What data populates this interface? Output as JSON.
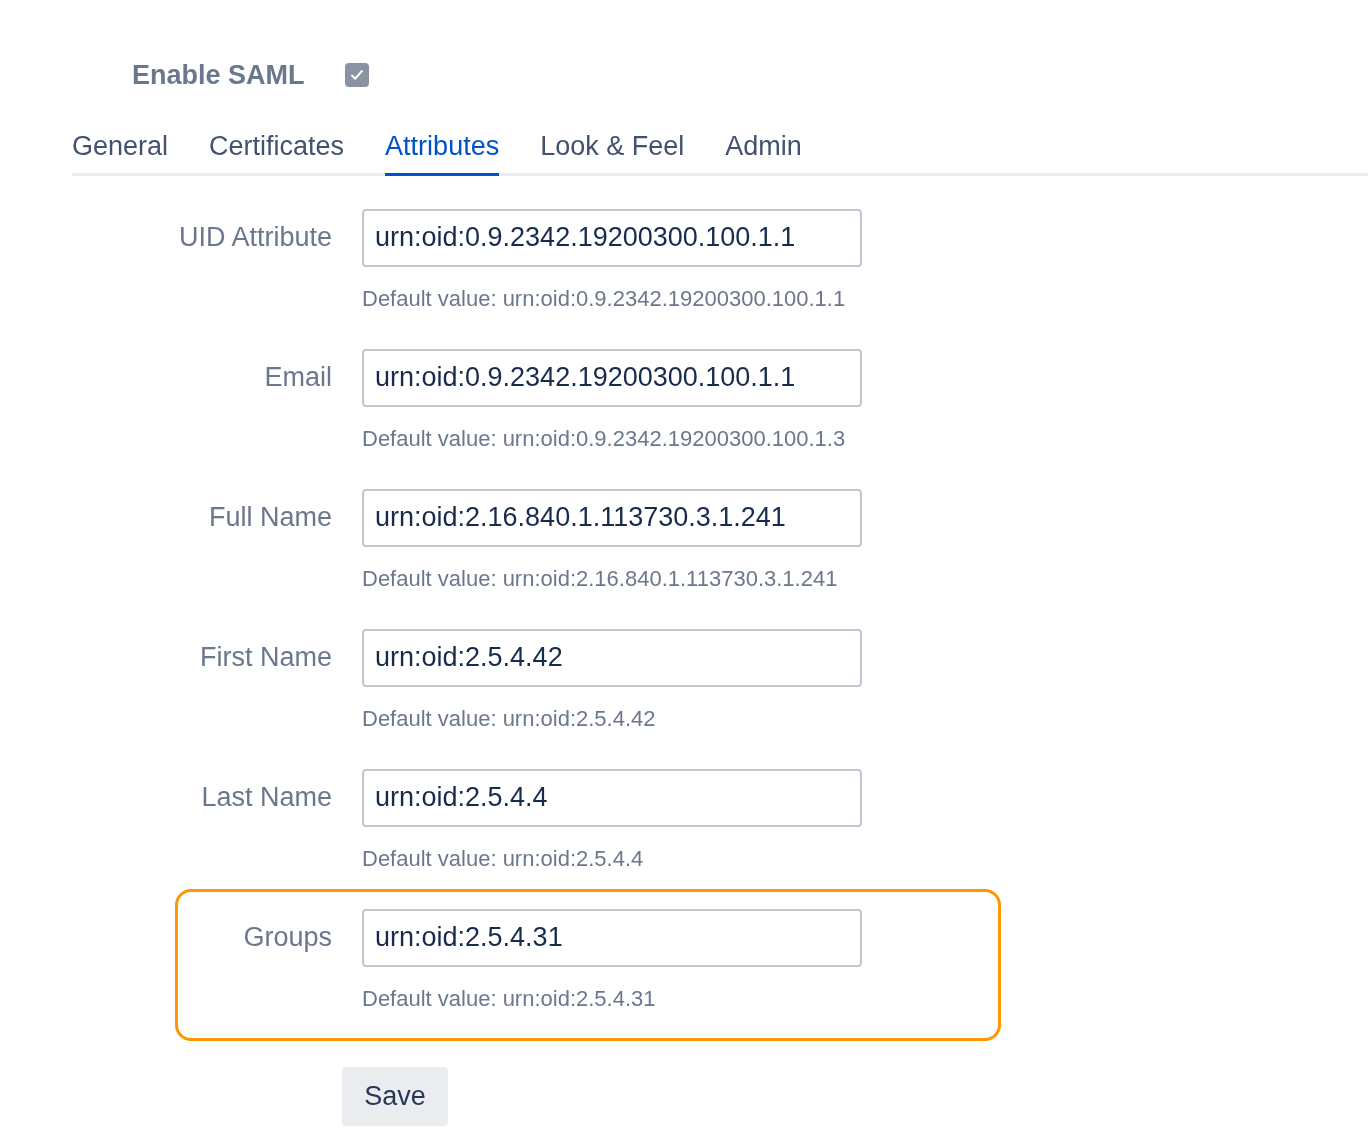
{
  "enable_saml": {
    "label": "Enable SAML",
    "checked": true
  },
  "tabs": [
    {
      "label": "General",
      "selected": false
    },
    {
      "label": "Certificates",
      "selected": false
    },
    {
      "label": "Attributes",
      "selected": true
    },
    {
      "label": "Look & Feel",
      "selected": false
    },
    {
      "label": "Admin",
      "selected": false
    }
  ],
  "fields": [
    {
      "label": "UID Attribute",
      "value": "urn:oid:0.9.2342.19200300.100.1.1",
      "hint": "Default value: urn:oid:0.9.2342.19200300.100.1.1",
      "highlighted": false
    },
    {
      "label": "Email",
      "value": "urn:oid:0.9.2342.19200300.100.1.1",
      "hint": "Default value: urn:oid:0.9.2342.19200300.100.1.3",
      "highlighted": false
    },
    {
      "label": "Full Name",
      "value": "urn:oid:2.16.840.1.113730.3.1.241",
      "hint": "Default value: urn:oid:2.16.840.1.113730.3.1.241",
      "highlighted": false
    },
    {
      "label": "First Name",
      "value": "urn:oid:2.5.4.42",
      "hint": "Default value: urn:oid:2.5.4.42",
      "highlighted": false
    },
    {
      "label": "Last Name",
      "value": "urn:oid:2.5.4.4",
      "hint": "Default value: urn:oid:2.5.4.4",
      "highlighted": false
    },
    {
      "label": "Groups",
      "value": "urn:oid:2.5.4.31",
      "hint": "Default value: urn:oid:2.5.4.31",
      "highlighted": true
    }
  ],
  "save_button": "Save"
}
